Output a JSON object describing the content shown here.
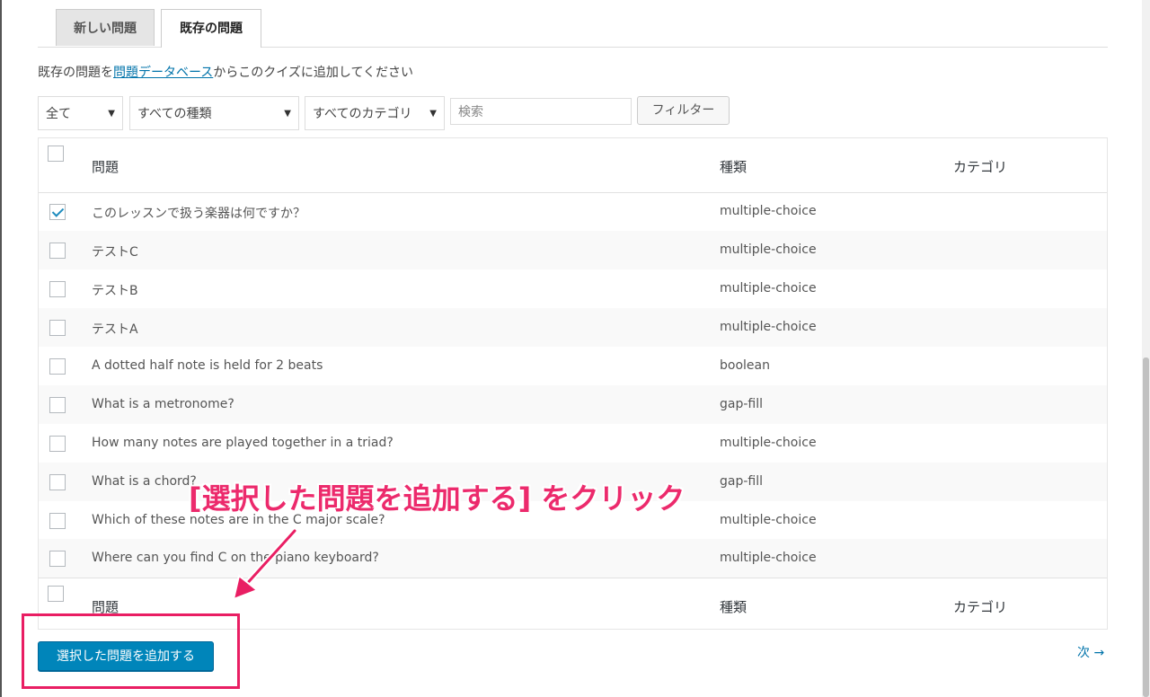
{
  "tabs": {
    "new_question": "新しい問題",
    "existing_question": "既存の問題"
  },
  "intro": {
    "prefix": "既存の問題を",
    "link": "問題データベース",
    "suffix": "からこのクイズに追加してください"
  },
  "filters": {
    "status_select": "全て",
    "type_select": "すべての種類",
    "category_select": "すべてのカテゴリ",
    "search_placeholder": "検索",
    "filter_button": "フィルター"
  },
  "table": {
    "headers": {
      "question": "問題",
      "type": "種類",
      "category": "カテゴリ"
    },
    "rows": [
      {
        "question": "このレッスンで扱う楽器は何ですか？",
        "type": "multiple-choice",
        "checked": true
      },
      {
        "question": "テストC",
        "type": "multiple-choice",
        "checked": false
      },
      {
        "question": "テストB",
        "type": "multiple-choice",
        "checked": false
      },
      {
        "question": "テストA",
        "type": "multiple-choice",
        "checked": false
      },
      {
        "question": "A dotted half note is held for 2 beats",
        "type": "boolean",
        "checked": false
      },
      {
        "question": "What is a metronome?",
        "type": "gap-fill",
        "checked": false
      },
      {
        "question": "How many notes are played together in a triad?",
        "type": "multiple-choice",
        "checked": false
      },
      {
        "question": "What is a chord?",
        "type": "gap-fill",
        "checked": false
      },
      {
        "question": "Which of these notes are in the C major scale?",
        "type": "multiple-choice",
        "checked": false
      },
      {
        "question": "Where can you find C on the piano keyboard?",
        "type": "multiple-choice",
        "checked": false
      }
    ]
  },
  "actions": {
    "add_selected_button": "選択した問題を追加する",
    "next_link": "次 →"
  },
  "annotation": {
    "callout": "[選択した問題を追加する] をクリック",
    "color": "#e91e63"
  }
}
